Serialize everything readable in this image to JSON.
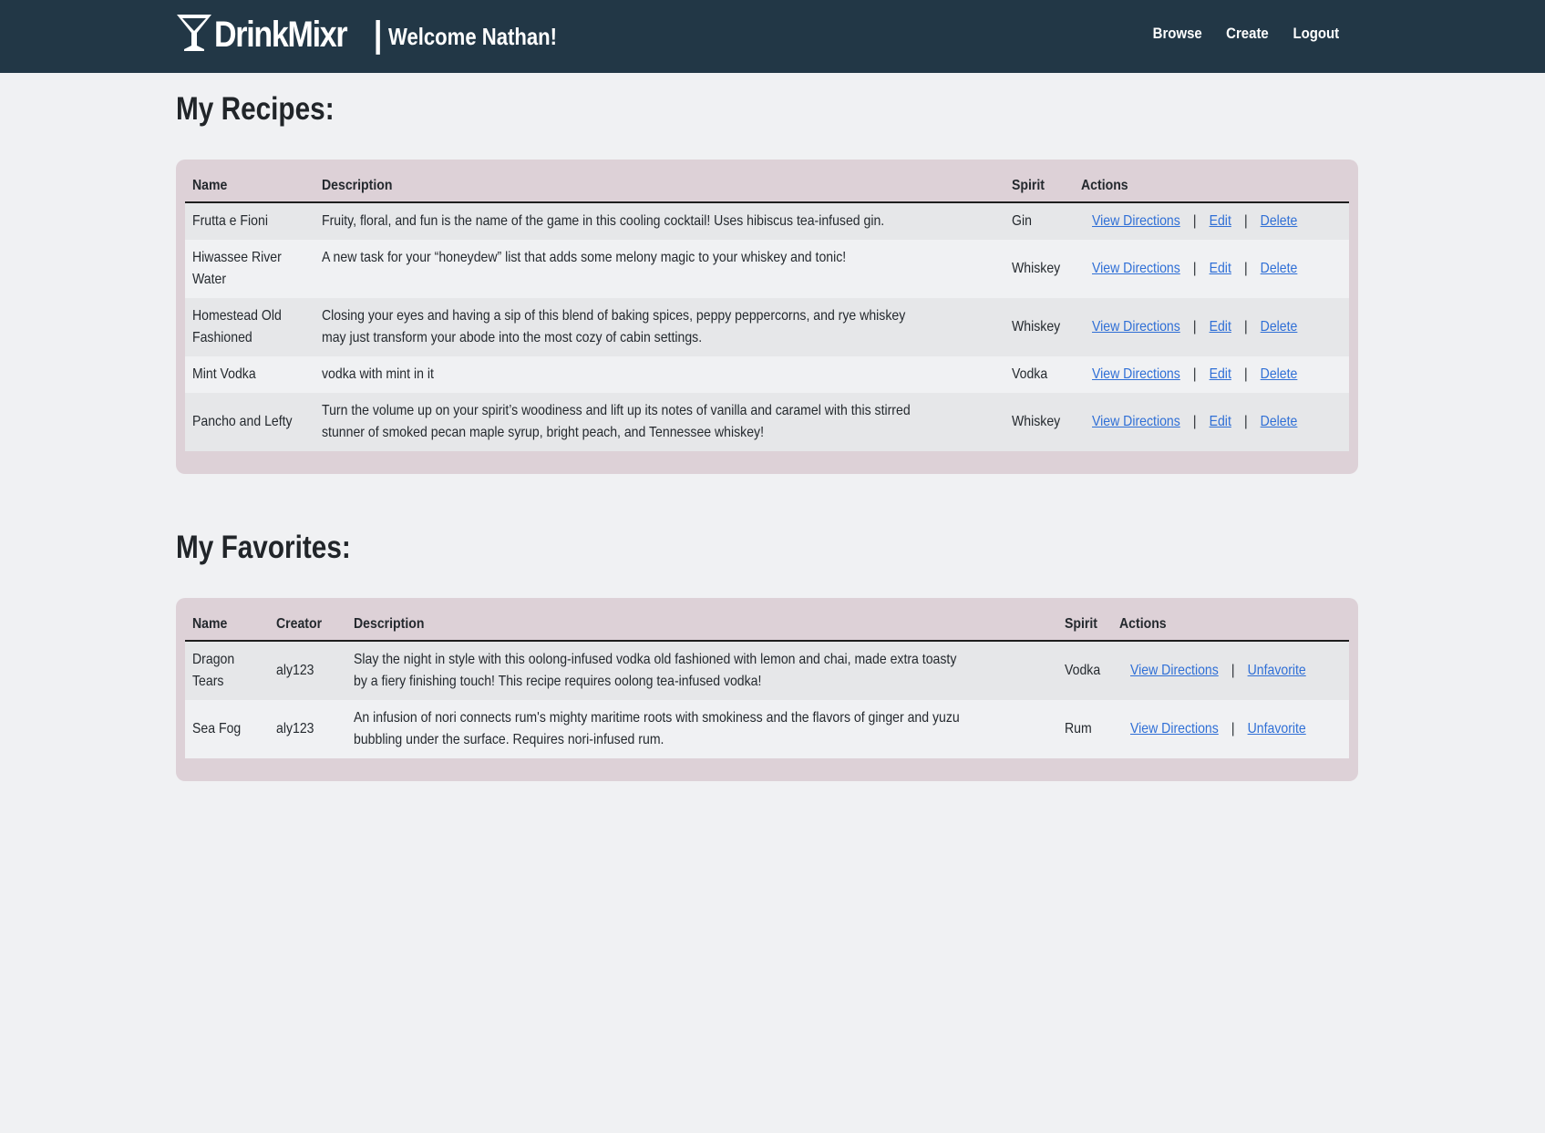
{
  "header": {
    "brand": "DrinkMixr",
    "separator": "|",
    "welcome": "Welcome Nathan!",
    "nav": [
      "Browse",
      "Create",
      "Logout"
    ]
  },
  "recipes": {
    "title": "My Recipes:",
    "columns": [
      "Name",
      "Description",
      "Spirit",
      "Actions"
    ],
    "rows": [
      {
        "name": "Frutta e Fioni",
        "description": "Fruity, floral, and fun is the name of the game in this cooling cocktail! Uses hibiscus tea-infused gin.",
        "spirit": "Gin"
      },
      {
        "name": "Hiwassee River Water",
        "description": "A new task for your “honeydew” list that adds some melony magic to your whiskey and tonic!",
        "spirit": "Whiskey"
      },
      {
        "name": "Homestead Old Fashioned",
        "description": "Closing your eyes and having a sip of this blend of baking spices, peppy peppercorns, and rye whiskey may just transform your abode into the most cozy of cabin settings.",
        "spirit": "Whiskey"
      },
      {
        "name": "Mint Vodka",
        "description": "vodka with mint in it",
        "spirit": "Vodka"
      },
      {
        "name": "Pancho and Lefty",
        "description": "Turn the volume up on your spirit’s woodiness and lift up its notes of vanilla and caramel with this stirred stunner of smoked pecan maple syrup, bright peach, and Tennessee whiskey!",
        "spirit": "Whiskey"
      }
    ],
    "actions": {
      "view": "View Directions",
      "edit": "Edit",
      "delete": "Delete",
      "sep": "|"
    }
  },
  "favorites": {
    "title": "My Favorites:",
    "columns": [
      "Name",
      "Creator",
      "Description",
      "Spirit",
      "Actions"
    ],
    "rows": [
      {
        "name": "Dragon Tears",
        "creator": "aly123",
        "description": "Slay the night in style with this oolong-infused vodka old fashioned with lemon and chai, made extra toasty by a fiery finishing touch! This recipe requires oolong tea-infused vodka!",
        "spirit": "Vodka"
      },
      {
        "name": "Sea Fog",
        "creator": "aly123",
        "description": "An infusion of nori connects rum's mighty maritime roots with smokiness and the flavors of ginger and yuzu bubbling under the surface. Requires nori-infused rum.",
        "spirit": "Rum"
      }
    ],
    "actions": {
      "view": "View Directions",
      "unfavorite": "Unfavorite",
      "sep": "|"
    }
  }
}
